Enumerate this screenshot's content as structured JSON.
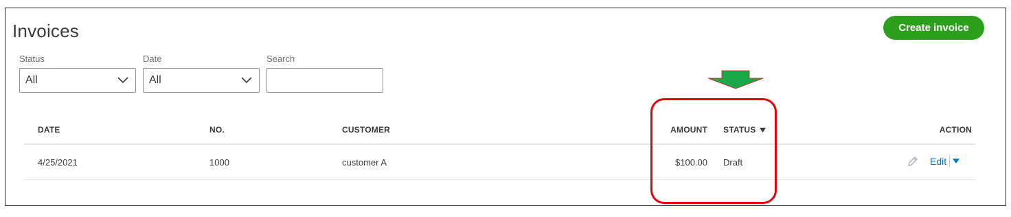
{
  "page": {
    "title": "Invoices",
    "create_button": "Create invoice"
  },
  "filters": {
    "status": {
      "label": "Status",
      "value": "All"
    },
    "date": {
      "label": "Date",
      "value": "All"
    },
    "search": {
      "label": "Search",
      "value": ""
    }
  },
  "table": {
    "headers": {
      "date": "DATE",
      "no": "NO.",
      "customer": "CUSTOMER",
      "amount": "AMOUNT",
      "status": "STATUS",
      "action": "ACTION"
    },
    "rows": [
      {
        "date": "4/25/2021",
        "no": "1000",
        "customer": "customer A",
        "amount": "$100.00",
        "status": "Draft",
        "action": "Edit"
      }
    ]
  },
  "colors": {
    "primary_green": "#2ca01c",
    "link_blue": "#0077c5",
    "highlight_red": "#e8000b",
    "arrow_green": "#1aa84b"
  },
  "icons": {
    "status_sort": "triangle-down",
    "row_edit": "pencil",
    "row_menu": "triangle-down"
  }
}
